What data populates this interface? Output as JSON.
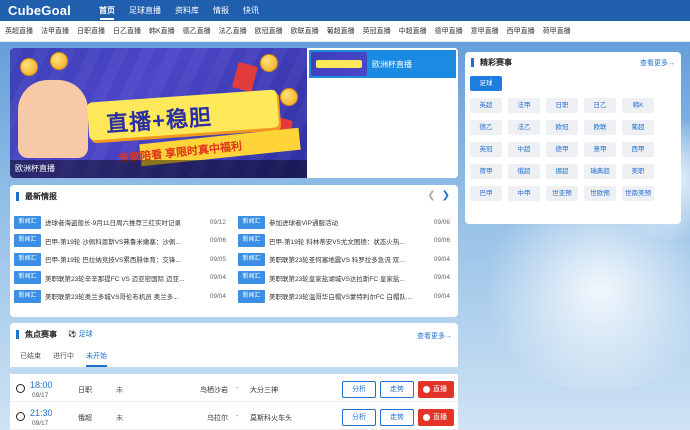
{
  "site": {
    "logo": "CubeGoal"
  },
  "topnav": [
    "首页",
    "足球直播",
    "资料库",
    "情报",
    "快讯"
  ],
  "leagues": [
    "英超直播",
    "法甲直播",
    "日职直播",
    "日乙直播",
    "韩K直播",
    "德乙直播",
    "法乙直播",
    "欧冠直播",
    "欧联直播",
    "葡超直播",
    "英冠直播",
    "中超直播",
    "德甲直播",
    "意甲直播",
    "西甲直播",
    "荷甲直播"
  ],
  "banner": {
    "headline": "直播+稳胆",
    "promo": "专家陪看  享限时真中福利",
    "caption": "欧洲杯直播",
    "side_label": "欧洲杯直播"
  },
  "featured": {
    "title": "精彩赛事",
    "more": "查看更多→",
    "tags": [
      "足球",
      "英超",
      "法甲",
      "日职",
      "日乙",
      "韩K",
      "德乙",
      "法乙",
      "欧冠",
      "欧联",
      "葡超",
      "英冠",
      "中超",
      "德甲",
      "意甲",
      "西甲",
      "荷甲",
      "俄超",
      "挪超",
      "瑞典超",
      "美职",
      "巴甲",
      "中甲",
      "世亚预",
      "世欧预",
      "世南美预"
    ]
  },
  "news": {
    "title": "最新情报",
    "badge": "新闻汇",
    "left": [
      {
        "text": "进球者海盗般长-9月11日周六推荐三红实时记录",
        "date": "09/12"
      },
      {
        "text": "巴甲-第19轮 沙佩科恩斯VS弗鲁米嫩塞：沙佩...",
        "date": "09/06"
      },
      {
        "text": "巴甲-第19轮 巴拉纳竞技VS累西腓体育：交锋...",
        "date": "09/05"
      },
      {
        "text": "美职联第23轮辛辛那提FC VS 迈亚密国际 迈亚...",
        "date": "09/04"
      },
      {
        "text": "美职联第23轮奥兰多城VS哥伦布机员 奥兰多...",
        "date": "09/04"
      }
    ],
    "right": [
      {
        "text": "参加进球者VIP通服活动",
        "date": "09/06"
      },
      {
        "text": "巴甲-第19轮 科林蒂安VS尤文图德：状态火热...",
        "date": "09/06"
      },
      {
        "text": "美职联第23轮圣何塞地震VS 科罗拉多急流 双...",
        "date": "09/04"
      },
      {
        "text": "美职联第23轮皇家盐湖城VS达拉斯FC 皇家盐...",
        "date": "09/04"
      },
      {
        "text": "美职联第23轮温哥华白帽VS蒙特利尔FC 白帽队...",
        "date": "09/04"
      }
    ]
  },
  "focus": {
    "title": "焦点赛事",
    "sport": "足球",
    "more": "查看更多→",
    "tabs": [
      "已结束",
      "进行中",
      "未开始"
    ],
    "matches": [
      {
        "time": "18:00",
        "date": "09/17",
        "league": "日职",
        "status": "未",
        "home": "鸟栖沙岩",
        "vs": "-",
        "away": "大分三神",
        "analyze": "分析",
        "trend": "走势",
        "live": "直播"
      },
      {
        "time": "21:30",
        "date": "09/17",
        "league": "俄超",
        "status": "未",
        "home": "乌拉尔",
        "vs": "-",
        "away": "莫斯科火车头",
        "analyze": "分析",
        "trend": "走势",
        "live": "直播"
      }
    ]
  }
}
